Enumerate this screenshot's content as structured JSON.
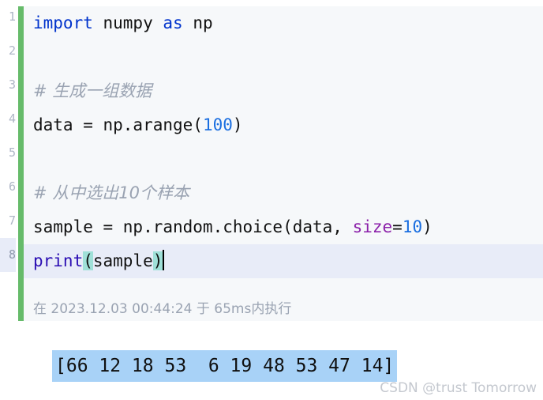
{
  "editor": {
    "line_numbers": [
      "1",
      "2",
      "3",
      "4",
      "5",
      "6",
      "7",
      "8"
    ],
    "lines": [
      {
        "number": "1",
        "tokens": [
          {
            "text": "import",
            "kind": "keyword"
          },
          {
            "text": " numpy ",
            "kind": "plain"
          },
          {
            "text": "as",
            "kind": "keyword"
          },
          {
            "text": " np",
            "kind": "plain"
          }
        ]
      },
      {
        "number": "2",
        "tokens": []
      },
      {
        "number": "3",
        "tokens": [
          {
            "text": "# 生成一组数据",
            "kind": "comment"
          }
        ]
      },
      {
        "number": "4",
        "tokens": [
          {
            "text": "data = np.arange(",
            "kind": "plain"
          },
          {
            "text": "100",
            "kind": "number"
          },
          {
            "text": ")",
            "kind": "plain"
          }
        ]
      },
      {
        "number": "5",
        "tokens": []
      },
      {
        "number": "6",
        "tokens": [
          {
            "text": "# 从中选出10个样本",
            "kind": "comment"
          }
        ]
      },
      {
        "number": "7",
        "tokens": [
          {
            "text": "sample = np.random.choice(data, ",
            "kind": "plain"
          },
          {
            "text": "size",
            "kind": "param"
          },
          {
            "text": "=",
            "kind": "plain"
          },
          {
            "text": "10",
            "kind": "number"
          },
          {
            "text": ")",
            "kind": "plain"
          }
        ]
      },
      {
        "number": "8",
        "current": true,
        "tokens": [
          {
            "text": "print",
            "kind": "builtin"
          },
          {
            "text": "(",
            "kind": "brace-match"
          },
          {
            "text": "sample",
            "kind": "plain"
          },
          {
            "text": ")",
            "kind": "brace-match"
          }
        ]
      }
    ],
    "accent_color": "#66bb6a",
    "background": "#f6f8fa",
    "current_line_background": "#e8ecf8"
  },
  "status": {
    "text": "在 2023.12.03 00:44:24 于 65ms内执行"
  },
  "output": {
    "text": "[66 12 18 53  6 19 48 53 47 14]",
    "highlight_color": "#a8d2f7",
    "values": [
      66,
      12,
      18,
      53,
      6,
      19,
      48,
      53,
      47,
      14
    ]
  },
  "watermark": {
    "text": "CSDN @trust Tomorrow"
  }
}
